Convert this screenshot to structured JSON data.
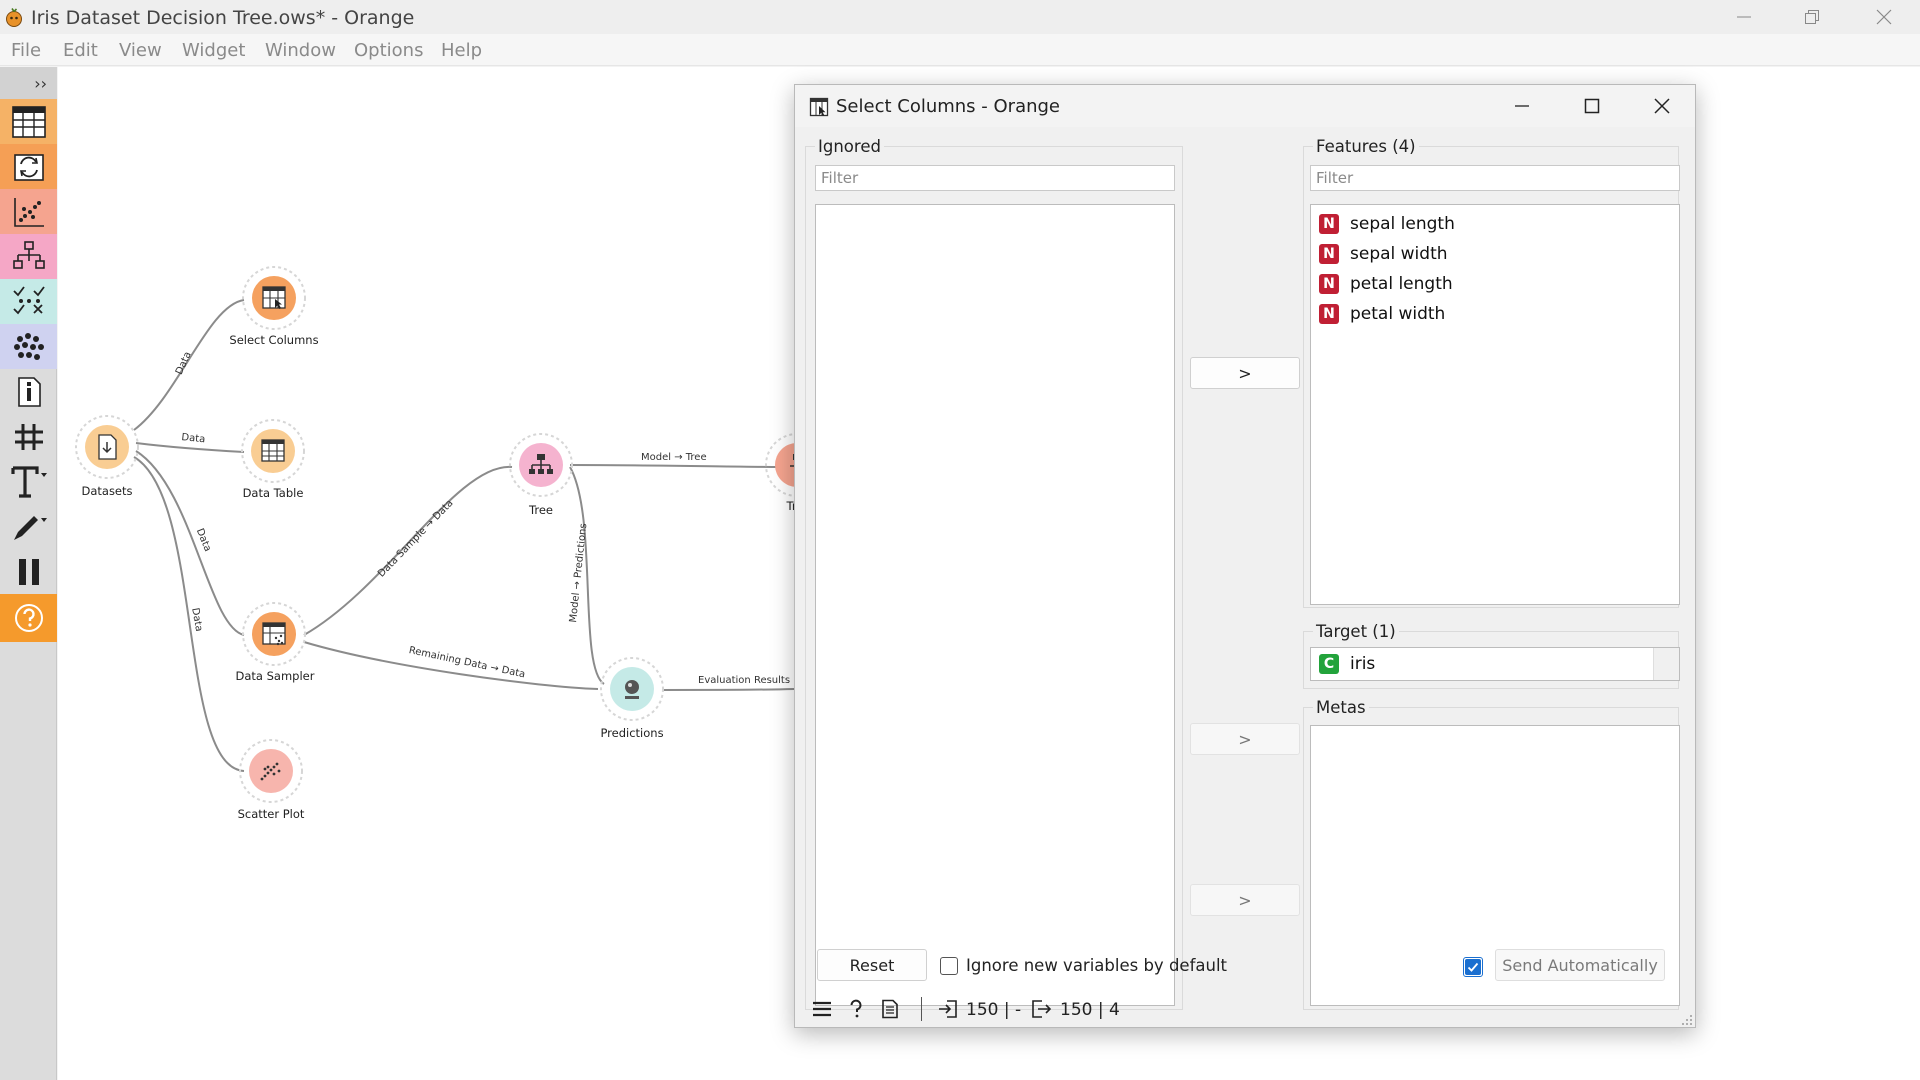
{
  "window": {
    "title": "Iris Dataset Decision Tree.ows* - Orange",
    "logo_icon": "orange-logo-icon"
  },
  "menu": [
    "File",
    "Edit",
    "View",
    "Widget",
    "Window",
    "Options",
    "Help"
  ],
  "toolbox": {
    "collapse_label": "››",
    "categories": [
      {
        "name": "data-icon",
        "color": "#f5b266"
      },
      {
        "name": "transform-icon",
        "color": "#f59f55"
      },
      {
        "name": "visualize-icon",
        "color": "#f5a48f"
      },
      {
        "name": "model-icon",
        "color": "#f5a7c6"
      },
      {
        "name": "evaluate-icon",
        "color": "#c5eae7"
      },
      {
        "name": "unsupervised-icon",
        "color": "#cfd2f0"
      },
      {
        "name": "info-icon",
        "color": "#dcdcdc"
      },
      {
        "name": "grid-icon",
        "color": "#dcdcdc"
      },
      {
        "name": "text-annotation-icon",
        "color": "#dcdcdc"
      },
      {
        "name": "pen-icon",
        "color": "#dcdcdc"
      },
      {
        "name": "pause-icon",
        "color": "#dcdcdc"
      },
      {
        "name": "help-icon",
        "color": "#f59a2c"
      }
    ]
  },
  "canvas": {
    "nodes": {
      "datasets": {
        "label": "Datasets",
        "color": "#f9cd93"
      },
      "select_columns": {
        "label": "Select Columns",
        "color": "#f5a15f"
      },
      "data_table": {
        "label": "Data Table",
        "color": "#f9cd93"
      },
      "data_sampler": {
        "label": "Data Sampler",
        "color": "#f5a15f"
      },
      "scatter_plot": {
        "label": "Scatter Plot",
        "color": "#f7b5ad"
      },
      "tree": {
        "label": "Tree",
        "color": "#f5b3cf"
      },
      "predictions": {
        "label": "Predictions",
        "color": "#c5eae7"
      },
      "tree_viewer": {
        "label": "Tree V",
        "color": "#f5a48f"
      }
    },
    "links": {
      "ds_sc": "Data",
      "ds_dt": "Data",
      "ds_samp": "Data",
      "ds_scatter": "Data",
      "samp_tree": "Data Sample → Data",
      "samp_pred": "Remaining Data → Data",
      "tree_tv": "Model → Tree",
      "tree_pred": "Model → Predictions",
      "pred_eval": "Evaluation Results"
    }
  },
  "dialog": {
    "title": "Select Columns - Orange",
    "ignored": {
      "title": "Ignored",
      "filter_placeholder": "Filter",
      "items": []
    },
    "features": {
      "title": "Features (4)",
      "filter_placeholder": "Filter",
      "items": [
        {
          "type": "N",
          "name": "sepal length"
        },
        {
          "type": "N",
          "name": "sepal width"
        },
        {
          "type": "N",
          "name": "petal length"
        },
        {
          "type": "N",
          "name": "petal width"
        }
      ],
      "numeric_color": "#c01f34"
    },
    "target": {
      "title": "Target (1)",
      "items": [
        {
          "type": "C",
          "name": "iris"
        }
      ],
      "categorical_color": "#22a33b"
    },
    "metas": {
      "title": "Metas",
      "items": []
    },
    "move_buttons": [
      ">",
      ">",
      ">"
    ],
    "reset_label": "Reset",
    "ignore_new_label": "Ignore new variables by default",
    "ignore_new_checked": false,
    "send_auto_label": "Send Automatically",
    "send_auto_checked": true,
    "status": {
      "input": "150 | -",
      "output": "150 | 4"
    }
  }
}
